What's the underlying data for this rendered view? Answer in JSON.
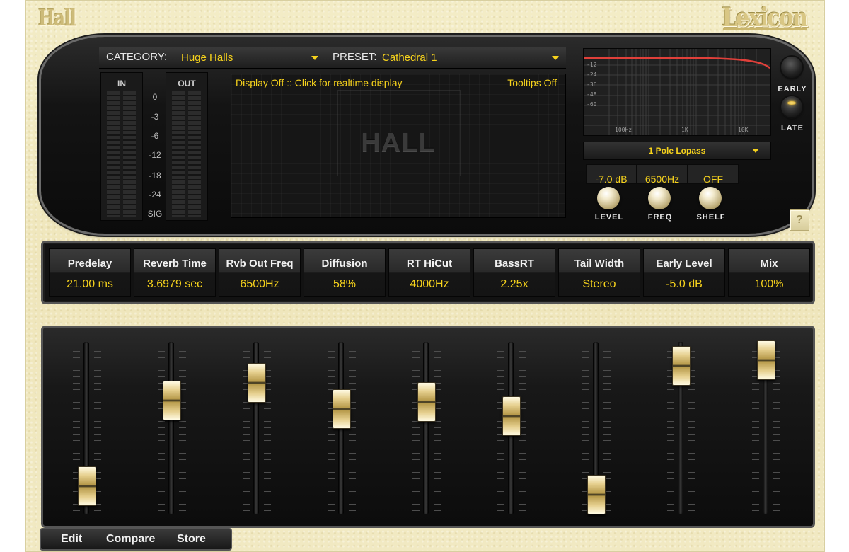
{
  "plugin": {
    "name": "Hall",
    "brand": "Lexicon"
  },
  "selectors": {
    "category_label": "CATEGORY:",
    "category_value": "Huge Halls",
    "preset_label": "PRESET:",
    "preset_value": "Cathedral 1"
  },
  "meters": {
    "in_label": "IN",
    "out_label": "OUT",
    "scale": [
      "0",
      "-3",
      "-6",
      "-12",
      "-18",
      "-24",
      "SIG"
    ]
  },
  "display": {
    "message": "Display Off :: Click for realtime display",
    "tooltips": "Tooltips Off",
    "logo": "HALL"
  },
  "eq": {
    "db_labels": [
      "-12",
      "-24",
      "-36",
      "-48",
      "-60"
    ],
    "freq_labels": [
      "100Hz",
      "1K",
      "10K"
    ],
    "curve_color": "#e0403a",
    "filter_type": "1 Pole Lopass",
    "values": {
      "level": "-7.0 dB",
      "freq": "6500Hz",
      "shelf": "OFF"
    },
    "knob_labels": {
      "level": "LEVEL",
      "freq": "FREQ",
      "shelf": "SHELF"
    }
  },
  "reflections": {
    "early": "EARLY",
    "late": "LATE",
    "active": "late"
  },
  "help_label": "?",
  "params": [
    {
      "name": "Predelay",
      "value": "21.00 ms"
    },
    {
      "name": "Reverb Time",
      "value": "3.6979 sec"
    },
    {
      "name": "Rvb Out Freq",
      "value": "6500Hz"
    },
    {
      "name": "Diffusion",
      "value": "58%"
    },
    {
      "name": "RT HiCut",
      "value": "4000Hz"
    },
    {
      "name": "BassRT",
      "value": "2.25x"
    },
    {
      "name": "Tail Width",
      "value": "Stereo"
    },
    {
      "name": "Early Level",
      "value": "-5.0 dB"
    },
    {
      "name": "Mix",
      "value": "100%"
    }
  ],
  "fader_levels": [
    0.1,
    0.7,
    0.82,
    0.64,
    0.69,
    0.59,
    0.04,
    0.94,
    0.98
  ],
  "footer": {
    "edit": "Edit",
    "compare": "Compare",
    "store": "Store"
  },
  "colors": {
    "accent": "#f6d21c",
    "panel": "#121212",
    "cream": "#f1e9c2"
  }
}
